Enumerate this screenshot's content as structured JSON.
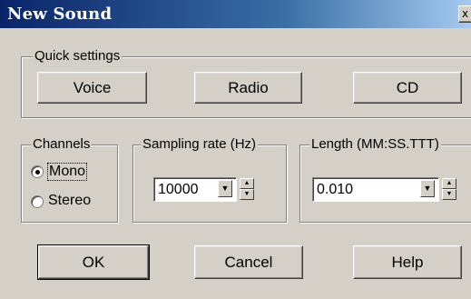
{
  "window": {
    "title": "New Sound",
    "close_glyph": "x"
  },
  "quick_settings": {
    "label": "Quick settings",
    "buttons": [
      "Voice",
      "Radio",
      "CD"
    ]
  },
  "channels": {
    "label": "Channels",
    "options": [
      {
        "label": "Mono",
        "selected": true
      },
      {
        "label": "Stereo",
        "selected": false
      }
    ]
  },
  "sampling_rate": {
    "label": "Sampling rate (Hz)",
    "value": "10000"
  },
  "length": {
    "label": "Length (MM:SS.TTT)",
    "value": "0.010"
  },
  "footer": {
    "ok_label": "OK",
    "cancel_label": "Cancel",
    "help_label": "Help"
  },
  "icons": {
    "dropdown": "chevron-down-icon",
    "spin_up": "arrow-up-icon",
    "spin_down": "arrow-down-icon",
    "close": "close-icon"
  }
}
